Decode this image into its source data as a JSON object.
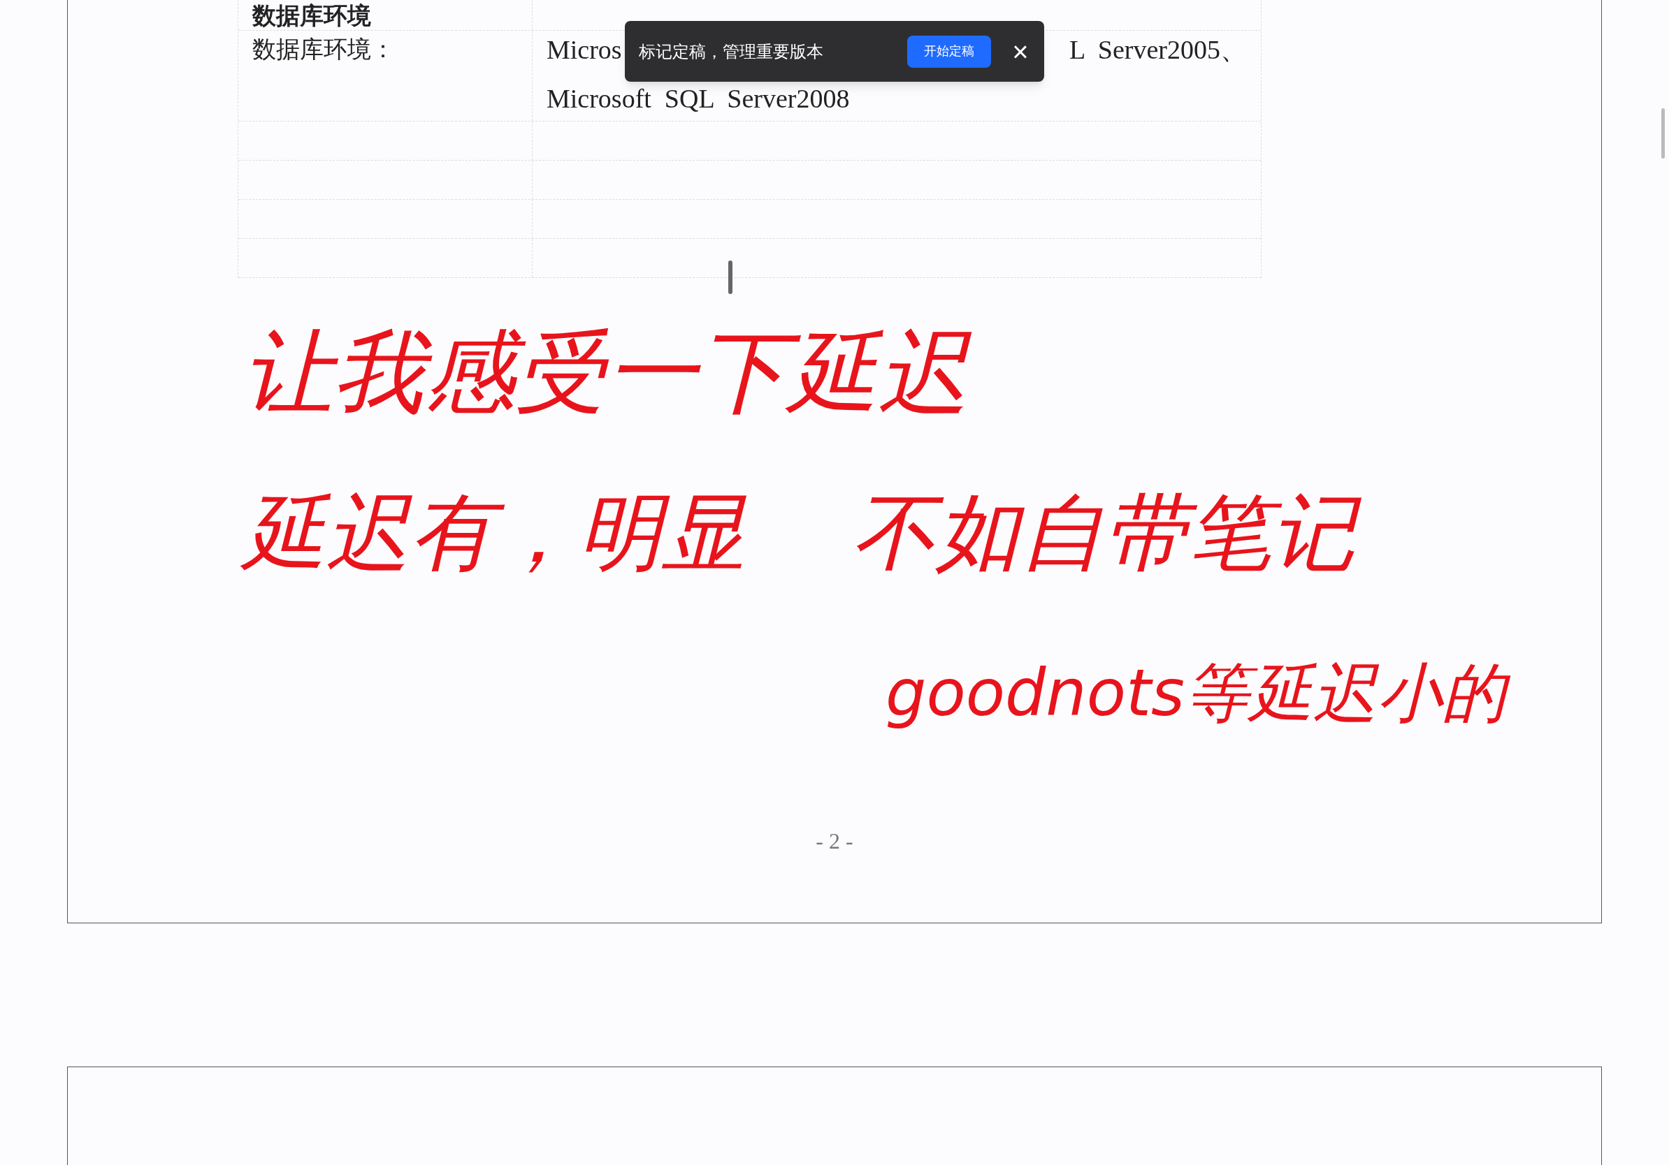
{
  "table": {
    "rows": [
      {
        "label": "数据库环境",
        "label_bold": true
      },
      {
        "label": "数据库环境：",
        "label_bold": false,
        "value_lines": [
          [
            "Micros",
            "L  Server2005、"
          ],
          [
            "Microsoft  SQL  Server2008"
          ]
        ]
      },
      {
        "kind": "empty"
      },
      {
        "kind": "empty"
      },
      {
        "kind": "empty"
      },
      {
        "kind": "empty"
      }
    ]
  },
  "handwriting": [
    [
      "让我感受一下延迟"
    ],
    [
      "延迟有，明显",
      "不如自带笔记"
    ],
    [
      "goodnots等延迟小的"
    ]
  ],
  "page_number": "- 2 -",
  "toast": {
    "message": "标记定稿，管理重要版本",
    "button": "开始定稿",
    "close": "×"
  }
}
